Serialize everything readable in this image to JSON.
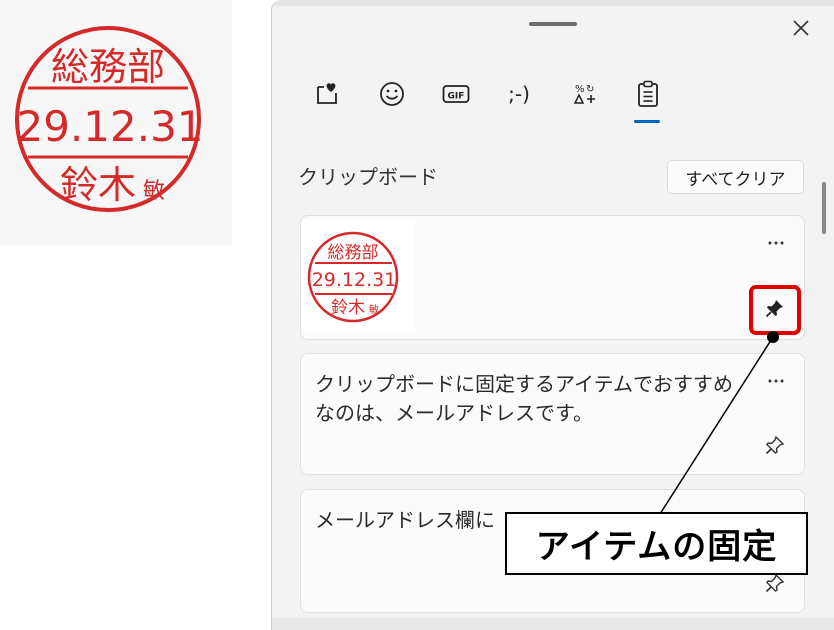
{
  "stamp": {
    "dept": "総務部",
    "date": "29.12.31",
    "name": "鈴木",
    "name_small": "敏",
    "color": "#d42a2a"
  },
  "panel": {
    "tabs": [
      {
        "icon": "kaomoji-favorites-icon"
      },
      {
        "icon": "emoji-smiley-icon"
      },
      {
        "icon": "gif-icon",
        "label": "GIF"
      },
      {
        "icon": "kaomoji-icon",
        "label": ";-)"
      },
      {
        "icon": "symbols-icon"
      },
      {
        "icon": "clipboard-icon",
        "selected": true
      }
    ],
    "section_title": "クリップボード",
    "clear_all_label": "すべてクリア",
    "items": [
      {
        "type": "image",
        "pinned": true
      },
      {
        "type": "text",
        "text": "クリップボードに固定するアイテムでおすすめなのは、メールアドレスです。",
        "pinned": false
      },
      {
        "type": "text",
        "text": "メールアドレス欄に",
        "pinned": false
      }
    ],
    "accent": "#0067c0"
  },
  "annotation": {
    "label": "アイテムの固定",
    "highlight_color": "#e50000"
  }
}
